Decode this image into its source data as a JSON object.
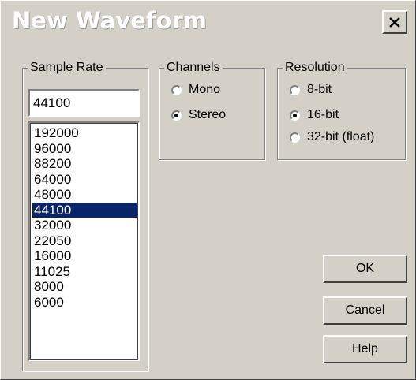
{
  "dialog": {
    "title": "New Waveform"
  },
  "sample_rate": {
    "label": "Sample Rate",
    "value": "44100",
    "options": [
      "192000",
      "96000",
      "88200",
      "64000",
      "48000",
      "44100",
      "32000",
      "22050",
      "16000",
      "11025",
      "8000",
      "6000"
    ],
    "selected": "44100"
  },
  "channels": {
    "label": "Channels",
    "options": [
      {
        "label": "Mono",
        "checked": false
      },
      {
        "label": "Stereo",
        "checked": true
      }
    ]
  },
  "resolution": {
    "label": "Resolution",
    "options": [
      {
        "label": "8-bit",
        "checked": false
      },
      {
        "label": "16-bit",
        "checked": true
      },
      {
        "label": "32-bit (float)",
        "checked": false
      }
    ]
  },
  "buttons": {
    "ok": "OK",
    "cancel": "Cancel",
    "help": "Help"
  },
  "colors": {
    "face": "#d4d0c8",
    "selection": "#0a246a"
  }
}
